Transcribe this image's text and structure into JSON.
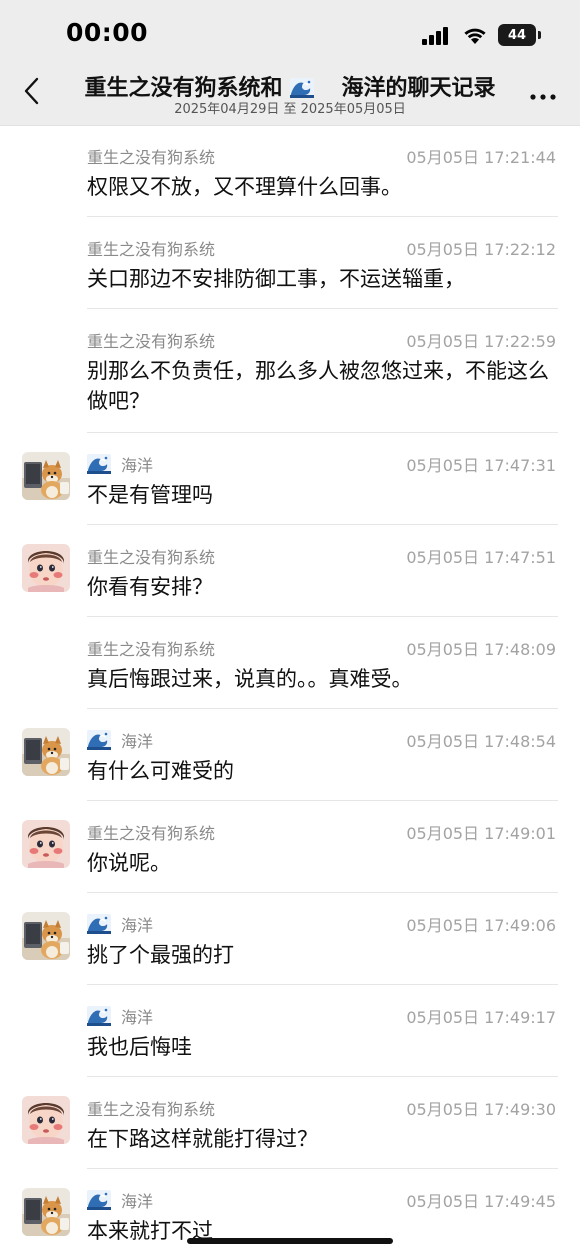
{
  "status_bar": {
    "time": "00:00",
    "battery": "44"
  },
  "header": {
    "title_part1": "重生之没有狗系统和",
    "title_part2": "海洋的聊天记录",
    "subtitle": "2025年04月29日 至 2025年05月05日"
  },
  "messages": [
    {
      "sender": "重生之没有狗系统",
      "time": "05月05日 17:21:44",
      "text": "权限又不放，又不理算什么回事。",
      "avatar": "none"
    },
    {
      "sender": "重生之没有狗系统",
      "time": "05月05日 17:22:12",
      "text": "关口那边不安排防御工事，不运送辎重，",
      "avatar": "none"
    },
    {
      "sender": "重生之没有狗系统",
      "time": "05月05日 17:22:59",
      "text": "别那么不负责任，那么多人被忽悠过来，不能这么做吧？",
      "avatar": "none"
    },
    {
      "sender": "海洋",
      "time": "05月05日 17:47:31",
      "text": "不是有管理吗",
      "avatar": "dog"
    },
    {
      "sender": "重生之没有狗系统",
      "time": "05月05日 17:47:51",
      "text": "你看有安排？",
      "avatar": "baby"
    },
    {
      "sender": "重生之没有狗系统",
      "time": "05月05日 17:48:09",
      "text": "真后悔跟过来，说真的。。真难受。",
      "avatar": "none"
    },
    {
      "sender": "海洋",
      "time": "05月05日 17:48:54",
      "text": "有什么可难受的",
      "avatar": "dog"
    },
    {
      "sender": "重生之没有狗系统",
      "time": "05月05日 17:49:01",
      "text": "你说呢。",
      "avatar": "baby"
    },
    {
      "sender": "海洋",
      "time": "05月05日 17:49:06",
      "text": "挑了个最强的打",
      "avatar": "dog"
    },
    {
      "sender": "海洋",
      "time": "05月05日 17:49:17",
      "text": "我也后悔哇",
      "avatar": "none"
    },
    {
      "sender": "重生之没有狗系统",
      "time": "05月05日 17:49:30",
      "text": "在下路这样就能打得过？",
      "avatar": "baby"
    },
    {
      "sender": "海洋",
      "time": "05月05日 17:49:45",
      "text": "本来就打不过",
      "avatar": "dog"
    }
  ]
}
